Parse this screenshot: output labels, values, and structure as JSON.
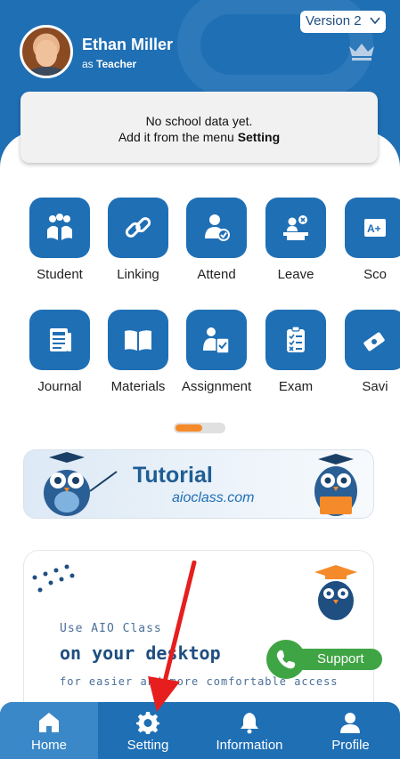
{
  "header": {
    "user_name": "Ethan Miller",
    "role_prefix": "as",
    "role": "Teacher",
    "version_label": "Version 2",
    "colors": {
      "primary": "#1f6fb5",
      "accent": "#f58a2a",
      "support": "#3fa544"
    }
  },
  "notice": {
    "line1": "No school data yet.",
    "line2_prefix": "Add it from the menu",
    "line2_emphasis": "Setting"
  },
  "menu": {
    "row1": [
      {
        "label": "Student",
        "icon": "students-reading-icon"
      },
      {
        "label": "Linking",
        "icon": "link-icon"
      },
      {
        "label": "Attend",
        "icon": "user-check-icon"
      },
      {
        "label": "Leave",
        "icon": "leave-desk-icon"
      },
      {
        "label": "Sco",
        "icon": "score-icon"
      }
    ],
    "row2": [
      {
        "label": "Journal",
        "icon": "journal-icon"
      },
      {
        "label": "Materials",
        "icon": "book-open-icon"
      },
      {
        "label": "Assignment",
        "icon": "assignment-icon"
      },
      {
        "label": "Exam",
        "icon": "exam-checklist-icon"
      },
      {
        "label": "Savi",
        "icon": "savings-icon"
      }
    ],
    "page_indicator": {
      "current": 1,
      "total": 2
    }
  },
  "tutorial": {
    "title": "Tutorial",
    "url": "aioclass.com"
  },
  "desktop_promo": {
    "line1": "Use AIO Class",
    "line2": "on your desktop",
    "line3": "for easier and more comfortable access"
  },
  "support": {
    "label": "Support",
    "icon": "phone-icon"
  },
  "bottom_nav": {
    "items": [
      {
        "label": "Home",
        "icon": "home-icon",
        "active": true
      },
      {
        "label": "Setting",
        "icon": "gear-icon",
        "active": false
      },
      {
        "label": "Information",
        "icon": "bell-icon",
        "active": false
      },
      {
        "label": "Profile",
        "icon": "person-icon",
        "active": false
      }
    ]
  }
}
